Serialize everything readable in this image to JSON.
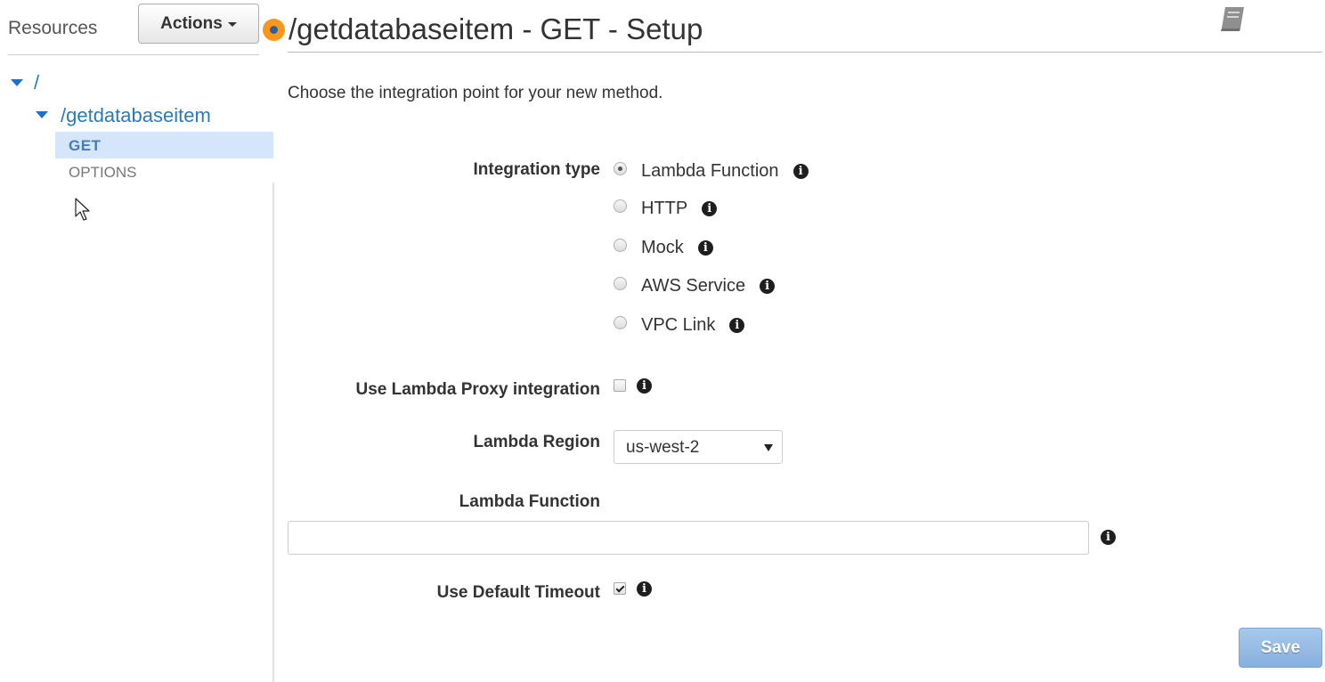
{
  "sidebar": {
    "title": "Resources",
    "actions_label": "Actions",
    "tree": {
      "root": "/",
      "resource": "/getdatabaseitem",
      "methods": [
        "GET",
        "OPTIONS"
      ],
      "selected_method": "GET"
    }
  },
  "header": {
    "title": "/getdatabaseitem - GET - Setup"
  },
  "main": {
    "intro": "Choose the integration point for your new method.",
    "integration_type": {
      "label": "Integration type",
      "options": [
        "Lambda Function",
        "HTTP",
        "Mock",
        "AWS Service",
        "VPC Link"
      ],
      "selected": "Lambda Function"
    },
    "proxy": {
      "label": "Use Lambda Proxy integration",
      "checked": false
    },
    "region": {
      "label": "Lambda Region",
      "value": "us-west-2"
    },
    "function": {
      "label": "Lambda Function",
      "value": "",
      "placeholder": ""
    },
    "timeout": {
      "label": "Use Default Timeout",
      "checked": true
    },
    "save_label": "Save"
  },
  "colors": {
    "link": "#2a7ab8",
    "selected_row": "#d5e6fb",
    "status_dot": "#f7981d",
    "save_button": "#87b0de"
  },
  "icons": [
    "info-icon",
    "docs-book-icon",
    "tree-expand-caret-icon",
    "status-dot-icon",
    "mouse-cursor-icon"
  ]
}
